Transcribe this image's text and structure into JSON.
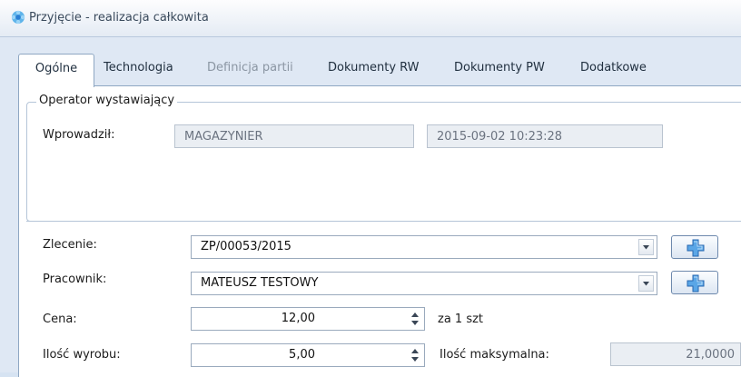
{
  "window": {
    "title": "Przyjęcie - realizacja całkowita",
    "icon": "gear-flower-icon"
  },
  "tabs": [
    {
      "label": "Ogólne",
      "state": "active"
    },
    {
      "label": "Technologia",
      "state": "normal"
    },
    {
      "label": "Definicja partii",
      "state": "disabled"
    },
    {
      "label": "Dokumenty RW",
      "state": "normal"
    },
    {
      "label": "Dokumenty PW",
      "state": "normal"
    },
    {
      "label": "Dodatkowe",
      "state": "normal"
    }
  ],
  "operator": {
    "legend": "Operator wystawiający",
    "entered_by_label": "Wprowadził:",
    "entered_by_value": "MAGAZYNIER",
    "entered_date_value": "2015-09-02 10:23:28"
  },
  "form": {
    "order_label": "Zlecenie:",
    "order_value": "ZP/00053/2015",
    "worker_label": "Pracownik:",
    "worker_value": "MATEUSZ TESTOWY",
    "price_label": "Cena:",
    "price_value": "12,00",
    "price_unit": "za 1 szt",
    "qty_label": "Ilość wyrobu:",
    "qty_value": "5,00",
    "max_qty_label": "Ilość maksymalna:",
    "max_qty_value": "21,0000"
  },
  "colors": {
    "accent": "#2a7fd4",
    "chrome": "#d6e3f2",
    "border": "#8fa7c3"
  }
}
